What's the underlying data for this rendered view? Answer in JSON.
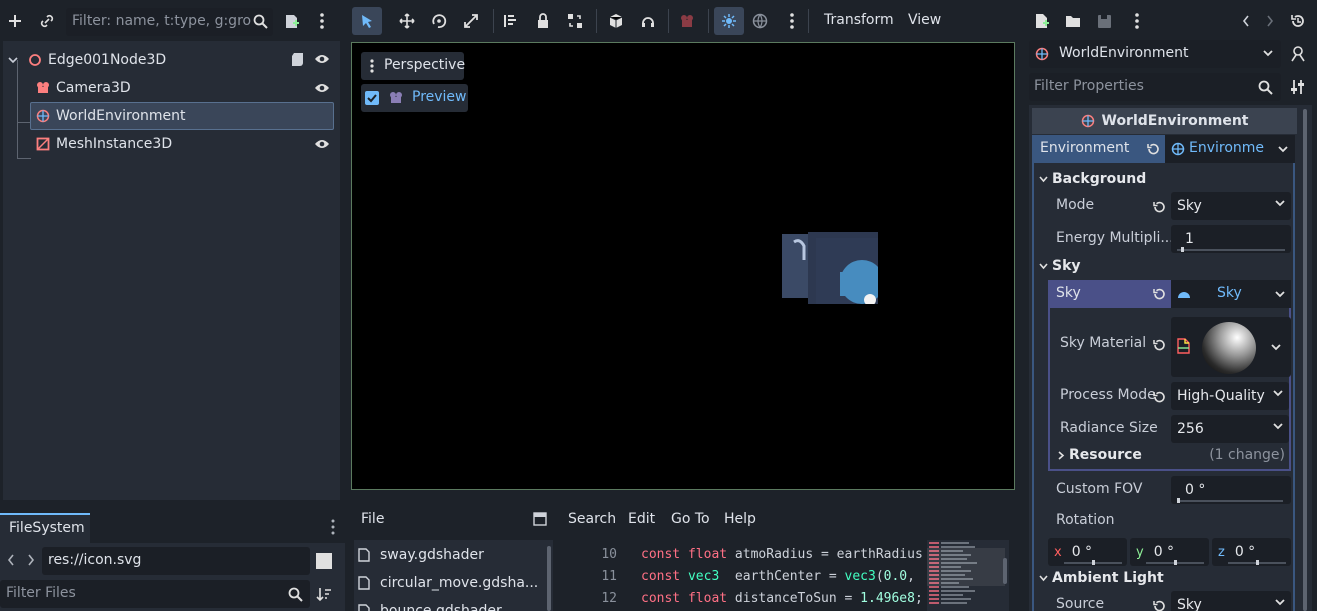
{
  "scene_dock": {
    "filter_placeholder": "Filter: name, t:type, g:grou",
    "nodes": [
      {
        "label": "Edge001Node3D",
        "icon": "node3d-icon"
      },
      {
        "label": "Camera3D",
        "icon": "camera-icon"
      },
      {
        "label": "WorldEnvironment",
        "icon": "world-environment-icon"
      },
      {
        "label": "MeshInstance3D",
        "icon": "mesh-instance-icon"
      }
    ]
  },
  "viewport_toolbar": {
    "transform_label": "Transform",
    "view_label": "View"
  },
  "viewport": {
    "perspective_label": "Perspective",
    "preview_label": "Preview",
    "preview_checked": true
  },
  "filesystem": {
    "tab_label": "FileSystem",
    "path": "res://icon.svg",
    "filter_placeholder": "Filter Files"
  },
  "script_editor": {
    "menu": [
      "File",
      "Search",
      "Edit",
      "Go To",
      "Help"
    ],
    "files": [
      "sway.gdshader",
      "circular_move.gdsha...",
      "bounce.gdshader"
    ],
    "lines": [
      {
        "num": "10",
        "parts": [
          {
            "t": "const ",
            "c": "kw"
          },
          {
            "t": "float",
            "c": "kw"
          },
          {
            "t": " atmoRadius = earthRadius",
            "c": "txt"
          }
        ]
      },
      {
        "num": "11",
        "parts": [
          {
            "t": "const ",
            "c": "kw"
          },
          {
            "t": "vec3",
            "c": "ty"
          },
          {
            "t": "  earthCenter = ",
            "c": "txt"
          },
          {
            "t": "vec3",
            "c": "ty"
          },
          {
            "t": "(",
            "c": "txt"
          },
          {
            "t": "0.0",
            "c": "num"
          },
          {
            "t": ",",
            "c": "txt"
          }
        ]
      },
      {
        "num": "12",
        "parts": [
          {
            "t": "const ",
            "c": "kw"
          },
          {
            "t": "float",
            "c": "kw"
          },
          {
            "t": " distanceToSun = ",
            "c": "txt"
          },
          {
            "t": "1.496e8",
            "c": "num"
          },
          {
            "t": ";",
            "c": "txt"
          }
        ]
      }
    ]
  },
  "inspector": {
    "node_selector": "WorldEnvironment",
    "filter_placeholder": "Filter Properties",
    "header": "WorldEnvironment",
    "environment_label": "Environment",
    "environment_value": "Environme",
    "sections": {
      "background": "Background",
      "sky": "Sky",
      "resource": "Resource",
      "resource_change": "(1 change)",
      "ambient_light": "Ambient Light"
    },
    "props": {
      "mode_label": "Mode",
      "mode_value": "Sky",
      "energy_label": "Energy Multipli...",
      "energy_value": "1",
      "sky_label": "Sky",
      "sky_value": "Sky",
      "sky_material_label": "Sky Material",
      "process_mode_label": "Process Mode",
      "process_mode_value": "High-Quality",
      "radiance_label": "Radiance Size",
      "radiance_value": "256",
      "fov_label": "Custom FOV",
      "fov_value": "0 °",
      "rotation_label": "Rotation",
      "rot_x_label": "x",
      "rot_x": "0 °",
      "rot_y_label": "y",
      "rot_y": "0 °",
      "rot_z_label": "z",
      "rot_z": "0 °",
      "source_label": "Source",
      "source_value": "Sky"
    }
  },
  "colors": {
    "accent": "#70bafa",
    "background": "#1d2229",
    "panel": "#262c36",
    "selected": "#3a4659",
    "sky_row": "#4a5088"
  }
}
